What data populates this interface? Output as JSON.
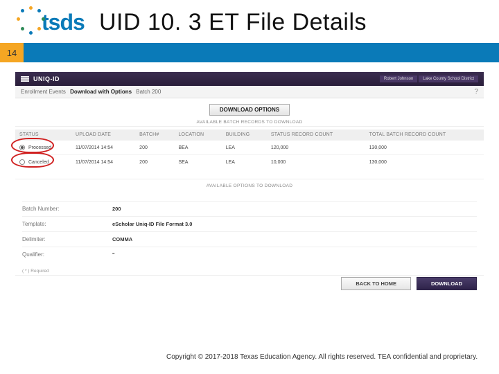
{
  "page": {
    "title": "UID 10. 3 ET File Details",
    "number": "14"
  },
  "app": {
    "name": "UNIQ-ID",
    "user": "Robert Johnson",
    "org": "Lake County School District"
  },
  "crumbs": {
    "section": "Enrollment Events",
    "page": "Download with Options",
    "batch": "Batch 200"
  },
  "buttons": {
    "download_options": "DOWNLOAD OPTIONS",
    "back": "BACK TO HOME",
    "download": "DOWNLOAD"
  },
  "labels": {
    "available_records": "AVAILABLE BATCH RECORDS TO DOWNLOAD",
    "available_options": "AVAILABLE OPTIONS TO DOWNLOAD"
  },
  "table": {
    "headers": {
      "status": "STATUS",
      "upload_date": "UPLOAD DATE",
      "batch": "BATCH#",
      "location": "LOCATION",
      "building": "BUILDING",
      "status_count": "STATUS RECORD COUNT",
      "total_count": "TOTAL BATCH RECORD COUNT"
    },
    "rows": [
      {
        "status": "Processed",
        "upload_date": "11/07/2014 14:54",
        "batch": "200",
        "location": "BEA",
        "building": "LEA",
        "status_count": "120,000",
        "total_count": "130,000"
      },
      {
        "status": "Canceled",
        "upload_date": "11/07/2014 14:54",
        "batch": "200",
        "location": "SEA",
        "building": "LEA",
        "status_count": "10,000",
        "total_count": "130,000"
      }
    ]
  },
  "details": {
    "batch_number": {
      "label": "Batch Number:",
      "value": "200"
    },
    "template": {
      "label": "Template:",
      "value": "eScholar Uniq-ID File Format 3.0"
    },
    "delimiter": {
      "label": "Delimiter:",
      "value": "COMMA"
    },
    "qualifier": {
      "label": "Qualifier:",
      "value": "\""
    }
  },
  "required_note": "( * ) Required",
  "copyright": "Copyright © 2017-2018 Texas Education Agency. All rights reserved. TEA confidential and proprietary."
}
